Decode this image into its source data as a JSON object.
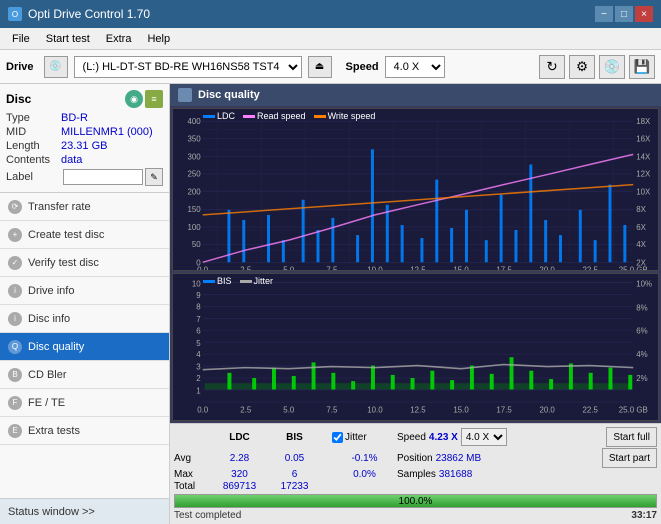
{
  "app": {
    "title": "Opti Drive Control 1.70",
    "icon": "ODC"
  },
  "titlebar": {
    "minimize": "−",
    "maximize": "□",
    "close": "×"
  },
  "menu": {
    "items": [
      "File",
      "Start test",
      "Extra",
      "Help"
    ]
  },
  "drivebar": {
    "label": "Drive",
    "drive_value": "(L:)  HL-DT-ST BD-RE  WH16NS58 TST4",
    "speed_label": "Speed",
    "speed_value": "4.0 X"
  },
  "disc": {
    "title": "Disc",
    "type_label": "Type",
    "type_val": "BD-R",
    "mid_label": "MID",
    "mid_val": "MILLENMR1 (000)",
    "length_label": "Length",
    "length_val": "23.31 GB",
    "contents_label": "Contents",
    "contents_val": "data",
    "label_label": "Label"
  },
  "nav": {
    "items": [
      {
        "id": "transfer-rate",
        "label": "Transfer rate",
        "active": false
      },
      {
        "id": "create-test-disc",
        "label": "Create test disc",
        "active": false
      },
      {
        "id": "verify-test-disc",
        "label": "Verify test disc",
        "active": false
      },
      {
        "id": "drive-info",
        "label": "Drive info",
        "active": false
      },
      {
        "id": "disc-info",
        "label": "Disc info",
        "active": false
      },
      {
        "id": "disc-quality",
        "label": "Disc quality",
        "active": true
      },
      {
        "id": "cd-bler",
        "label": "CD Bler",
        "active": false
      },
      {
        "id": "fe-te",
        "label": "FE / TE",
        "active": false
      },
      {
        "id": "extra-tests",
        "label": "Extra tests",
        "active": false
      }
    ]
  },
  "status_window": {
    "label": "Status window >> "
  },
  "chart": {
    "title": "Disc quality",
    "top": {
      "legend": [
        {
          "id": "ldc",
          "label": "LDC",
          "color": "#0080ff"
        },
        {
          "id": "read-speed",
          "label": "Read speed",
          "color": "#ff80ff"
        },
        {
          "id": "write-speed",
          "label": "Write speed",
          "color": "#ff8000"
        }
      ],
      "y_left": [
        "400",
        "350",
        "300",
        "250",
        "200",
        "150",
        "100",
        "50",
        "0"
      ],
      "y_right": [
        "18X",
        "16X",
        "14X",
        "12X",
        "10X",
        "8X",
        "6X",
        "4X",
        "2X"
      ],
      "x_labels": [
        "0.0",
        "2.5",
        "5.0",
        "7.5",
        "10.0",
        "12.5",
        "15.0",
        "17.5",
        "20.0",
        "22.5",
        "25.0 GB"
      ]
    },
    "bottom": {
      "legend": [
        {
          "id": "bis",
          "label": "BIS",
          "color": "#0080ff"
        },
        {
          "id": "jitter",
          "label": "Jitter",
          "color": "#808080"
        }
      ],
      "y_left": [
        "10",
        "9",
        "8",
        "7",
        "6",
        "5",
        "4",
        "3",
        "2",
        "1"
      ],
      "y_right": [
        "10%",
        "8%",
        "6%",
        "4%",
        "2%"
      ],
      "x_labels": [
        "0.0",
        "2.5",
        "5.0",
        "7.5",
        "10.0",
        "12.5",
        "15.0",
        "17.5",
        "20.0",
        "22.5",
        "25.0 GB"
      ]
    }
  },
  "stats": {
    "headers": [
      "",
      "LDC",
      "BIS",
      "",
      "Jitter",
      "Speed",
      ""
    ],
    "avg_label": "Avg",
    "avg_ldc": "2.28",
    "avg_bis": "0.05",
    "avg_jitter": "-0.1%",
    "max_label": "Max",
    "max_ldc": "320",
    "max_bis": "6",
    "max_jitter": "0.0%",
    "total_label": "Total",
    "total_ldc": "869713",
    "total_bis": "17233",
    "speed_label": "Speed",
    "speed_val": "4.23 X",
    "speed_select": "4.0 X",
    "position_label": "Position",
    "position_val": "23862 MB",
    "samples_label": "Samples",
    "samples_val": "381688",
    "jitter_checked": true,
    "start_full": "Start full",
    "start_part": "Start part"
  },
  "progress": {
    "value": 100.0,
    "display": "100.0%"
  },
  "status_bar": {
    "text": "Test completed",
    "time": "33:17"
  }
}
